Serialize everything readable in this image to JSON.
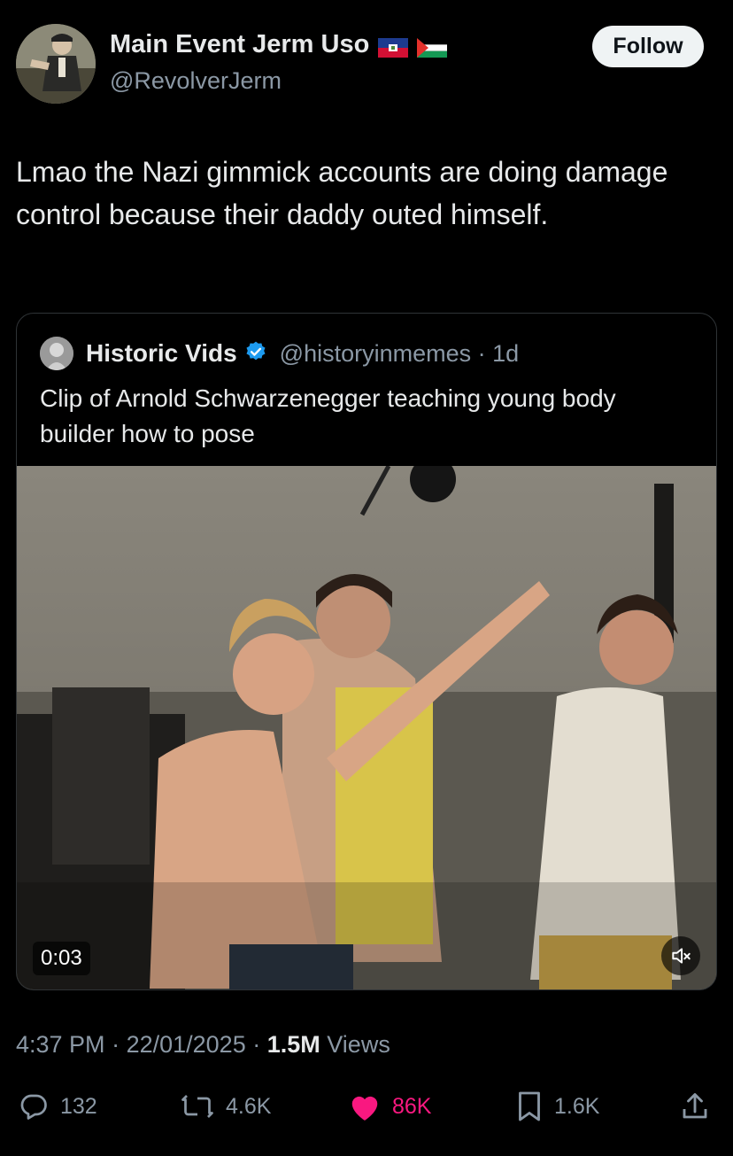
{
  "author": {
    "display_name": "Main Event Jerm Uso",
    "handle": "@RevolverJerm",
    "flags": [
      "haiti-flag-icon",
      "palestine-flag-icon"
    ]
  },
  "follow_label": "Follow",
  "tweet": {
    "text": "Lmao the Nazi gimmick accounts are doing damage control because their daddy outed himself."
  },
  "quoted": {
    "name": "Historic Vids",
    "verified_icon": "verified-badge-icon",
    "handle_time": "@historyinmemes · 1d",
    "text": "Clip of Arnold Schwarzenegger teaching young body builder how to pose",
    "video": {
      "time": "0:03",
      "mute_icon": "speaker-muted-icon"
    }
  },
  "meta": {
    "time": "4:37 PM",
    "date": "22/01/2025",
    "views_count": "1.5M",
    "views_label": "Views"
  },
  "actions": {
    "replies": "132",
    "reposts": "4.6K",
    "likes": "86K",
    "bookmarks": "1.6K"
  },
  "colors": {
    "background": "#000000",
    "text": "#e7e9ea",
    "secondary": "#8b98a5",
    "like": "#f91880",
    "verified": "#1d9bf0"
  }
}
